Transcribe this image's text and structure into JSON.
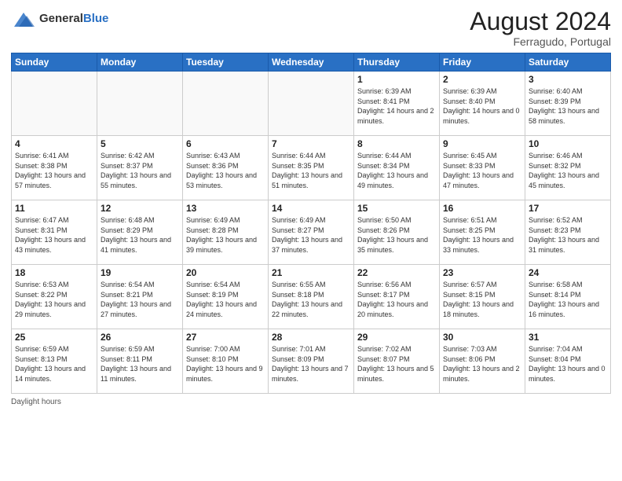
{
  "header": {
    "logo_general": "General",
    "logo_blue": "Blue",
    "month_year": "August 2024",
    "location": "Ferragudo, Portugal"
  },
  "footer": {
    "daylight_label": "Daylight hours"
  },
  "weekdays": [
    "Sunday",
    "Monday",
    "Tuesday",
    "Wednesday",
    "Thursday",
    "Friday",
    "Saturday"
  ],
  "weeks": [
    [
      {
        "day": "",
        "sunrise": "",
        "sunset": "",
        "daylight": "",
        "empty": true
      },
      {
        "day": "",
        "sunrise": "",
        "sunset": "",
        "daylight": "",
        "empty": true
      },
      {
        "day": "",
        "sunrise": "",
        "sunset": "",
        "daylight": "",
        "empty": true
      },
      {
        "day": "",
        "sunrise": "",
        "sunset": "",
        "daylight": "",
        "empty": true
      },
      {
        "day": "1",
        "sunrise": "Sunrise: 6:39 AM",
        "sunset": "Sunset: 8:41 PM",
        "daylight": "Daylight: 14 hours and 2 minutes.",
        "empty": false
      },
      {
        "day": "2",
        "sunrise": "Sunrise: 6:39 AM",
        "sunset": "Sunset: 8:40 PM",
        "daylight": "Daylight: 14 hours and 0 minutes.",
        "empty": false
      },
      {
        "day": "3",
        "sunrise": "Sunrise: 6:40 AM",
        "sunset": "Sunset: 8:39 PM",
        "daylight": "Daylight: 13 hours and 58 minutes.",
        "empty": false
      }
    ],
    [
      {
        "day": "4",
        "sunrise": "Sunrise: 6:41 AM",
        "sunset": "Sunset: 8:38 PM",
        "daylight": "Daylight: 13 hours and 57 minutes.",
        "empty": false
      },
      {
        "day": "5",
        "sunrise": "Sunrise: 6:42 AM",
        "sunset": "Sunset: 8:37 PM",
        "daylight": "Daylight: 13 hours and 55 minutes.",
        "empty": false
      },
      {
        "day": "6",
        "sunrise": "Sunrise: 6:43 AM",
        "sunset": "Sunset: 8:36 PM",
        "daylight": "Daylight: 13 hours and 53 minutes.",
        "empty": false
      },
      {
        "day": "7",
        "sunrise": "Sunrise: 6:44 AM",
        "sunset": "Sunset: 8:35 PM",
        "daylight": "Daylight: 13 hours and 51 minutes.",
        "empty": false
      },
      {
        "day": "8",
        "sunrise": "Sunrise: 6:44 AM",
        "sunset": "Sunset: 8:34 PM",
        "daylight": "Daylight: 13 hours and 49 minutes.",
        "empty": false
      },
      {
        "day": "9",
        "sunrise": "Sunrise: 6:45 AM",
        "sunset": "Sunset: 8:33 PM",
        "daylight": "Daylight: 13 hours and 47 minutes.",
        "empty": false
      },
      {
        "day": "10",
        "sunrise": "Sunrise: 6:46 AM",
        "sunset": "Sunset: 8:32 PM",
        "daylight": "Daylight: 13 hours and 45 minutes.",
        "empty": false
      }
    ],
    [
      {
        "day": "11",
        "sunrise": "Sunrise: 6:47 AM",
        "sunset": "Sunset: 8:31 PM",
        "daylight": "Daylight: 13 hours and 43 minutes.",
        "empty": false
      },
      {
        "day": "12",
        "sunrise": "Sunrise: 6:48 AM",
        "sunset": "Sunset: 8:29 PM",
        "daylight": "Daylight: 13 hours and 41 minutes.",
        "empty": false
      },
      {
        "day": "13",
        "sunrise": "Sunrise: 6:49 AM",
        "sunset": "Sunset: 8:28 PM",
        "daylight": "Daylight: 13 hours and 39 minutes.",
        "empty": false
      },
      {
        "day": "14",
        "sunrise": "Sunrise: 6:49 AM",
        "sunset": "Sunset: 8:27 PM",
        "daylight": "Daylight: 13 hours and 37 minutes.",
        "empty": false
      },
      {
        "day": "15",
        "sunrise": "Sunrise: 6:50 AM",
        "sunset": "Sunset: 8:26 PM",
        "daylight": "Daylight: 13 hours and 35 minutes.",
        "empty": false
      },
      {
        "day": "16",
        "sunrise": "Sunrise: 6:51 AM",
        "sunset": "Sunset: 8:25 PM",
        "daylight": "Daylight: 13 hours and 33 minutes.",
        "empty": false
      },
      {
        "day": "17",
        "sunrise": "Sunrise: 6:52 AM",
        "sunset": "Sunset: 8:23 PM",
        "daylight": "Daylight: 13 hours and 31 minutes.",
        "empty": false
      }
    ],
    [
      {
        "day": "18",
        "sunrise": "Sunrise: 6:53 AM",
        "sunset": "Sunset: 8:22 PM",
        "daylight": "Daylight: 13 hours and 29 minutes.",
        "empty": false
      },
      {
        "day": "19",
        "sunrise": "Sunrise: 6:54 AM",
        "sunset": "Sunset: 8:21 PM",
        "daylight": "Daylight: 13 hours and 27 minutes.",
        "empty": false
      },
      {
        "day": "20",
        "sunrise": "Sunrise: 6:54 AM",
        "sunset": "Sunset: 8:19 PM",
        "daylight": "Daylight: 13 hours and 24 minutes.",
        "empty": false
      },
      {
        "day": "21",
        "sunrise": "Sunrise: 6:55 AM",
        "sunset": "Sunset: 8:18 PM",
        "daylight": "Daylight: 13 hours and 22 minutes.",
        "empty": false
      },
      {
        "day": "22",
        "sunrise": "Sunrise: 6:56 AM",
        "sunset": "Sunset: 8:17 PM",
        "daylight": "Daylight: 13 hours and 20 minutes.",
        "empty": false
      },
      {
        "day": "23",
        "sunrise": "Sunrise: 6:57 AM",
        "sunset": "Sunset: 8:15 PM",
        "daylight": "Daylight: 13 hours and 18 minutes.",
        "empty": false
      },
      {
        "day": "24",
        "sunrise": "Sunrise: 6:58 AM",
        "sunset": "Sunset: 8:14 PM",
        "daylight": "Daylight: 13 hours and 16 minutes.",
        "empty": false
      }
    ],
    [
      {
        "day": "25",
        "sunrise": "Sunrise: 6:59 AM",
        "sunset": "Sunset: 8:13 PM",
        "daylight": "Daylight: 13 hours and 14 minutes.",
        "empty": false
      },
      {
        "day": "26",
        "sunrise": "Sunrise: 6:59 AM",
        "sunset": "Sunset: 8:11 PM",
        "daylight": "Daylight: 13 hours and 11 minutes.",
        "empty": false
      },
      {
        "day": "27",
        "sunrise": "Sunrise: 7:00 AM",
        "sunset": "Sunset: 8:10 PM",
        "daylight": "Daylight: 13 hours and 9 minutes.",
        "empty": false
      },
      {
        "day": "28",
        "sunrise": "Sunrise: 7:01 AM",
        "sunset": "Sunset: 8:09 PM",
        "daylight": "Daylight: 13 hours and 7 minutes.",
        "empty": false
      },
      {
        "day": "29",
        "sunrise": "Sunrise: 7:02 AM",
        "sunset": "Sunset: 8:07 PM",
        "daylight": "Daylight: 13 hours and 5 minutes.",
        "empty": false
      },
      {
        "day": "30",
        "sunrise": "Sunrise: 7:03 AM",
        "sunset": "Sunset: 8:06 PM",
        "daylight": "Daylight: 13 hours and 2 minutes.",
        "empty": false
      },
      {
        "day": "31",
        "sunrise": "Sunrise: 7:04 AM",
        "sunset": "Sunset: 8:04 PM",
        "daylight": "Daylight: 13 hours and 0 minutes.",
        "empty": false
      }
    ]
  ]
}
